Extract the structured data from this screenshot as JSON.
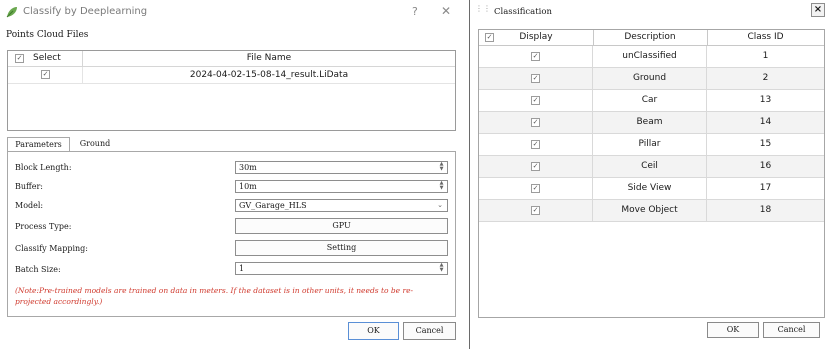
{
  "left_dialog": {
    "title": "Classify by Deeplearning",
    "help_glyph": "?",
    "close_glyph": "✕",
    "points_cloud_label": "Points Cloud Files",
    "file_table": {
      "headers": [
        "Select",
        "File Name"
      ],
      "rows": [
        {
          "checked": true,
          "file_name": "2024-04-02-15-08-14_result.LiData"
        }
      ]
    },
    "tabs": [
      "Parameters",
      "Ground"
    ],
    "params": {
      "block_length": {
        "label": "Block Length:",
        "value": "30m"
      },
      "buffer": {
        "label": "Buffer:",
        "value": "10m"
      },
      "model": {
        "label": "Model:",
        "value": "GV_Garage_HLS"
      },
      "process_type": {
        "label": "Process Type:",
        "value": "GPU"
      },
      "classify_mapping": {
        "label": "Classify Mapping:",
        "value": "Setting"
      },
      "batch_size": {
        "label": "Batch Size:",
        "value": "1"
      }
    },
    "note": "(Note:Pre-trained models are trained on data in meters. If the dataset is in other units, it needs to be re-projected accordingly.)",
    "ok_label": "OK",
    "cancel_label": "Cancel"
  },
  "right_panel": {
    "title": "Classification",
    "close_glyph": "×",
    "table": {
      "headers": [
        "Display",
        "Description",
        "Class ID"
      ],
      "rows": [
        {
          "display": true,
          "description": "unClassified",
          "class_id": "1"
        },
        {
          "display": true,
          "description": "Ground",
          "class_id": "2"
        },
        {
          "display": true,
          "description": "Car",
          "class_id": "13"
        },
        {
          "display": true,
          "description": "Beam",
          "class_id": "14"
        },
        {
          "display": true,
          "description": "Pillar",
          "class_id": "15"
        },
        {
          "display": true,
          "description": "Ceil",
          "class_id": "16"
        },
        {
          "display": true,
          "description": "Side View",
          "class_id": "17"
        },
        {
          "display": true,
          "description": "Move Object",
          "class_id": "18"
        }
      ]
    },
    "ok_label": "OK",
    "cancel_label": "Cancel"
  },
  "colors": {
    "note_text": "#d03a2e",
    "ok_focus_border": "#5a8fd6",
    "alt_row": "#f3f3f3"
  },
  "icons": {
    "app_icon": "leaf-icon",
    "spin": "spinner-arrows-icon",
    "dropdown": "chevron-down-icon",
    "checkbox": "checkmark-icon"
  }
}
